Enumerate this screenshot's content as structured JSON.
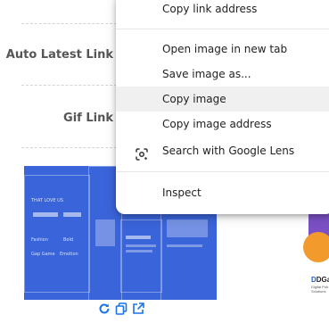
{
  "page": {
    "row_labels": [
      "Auto Latest Link",
      "Gif Link"
    ],
    "thumbnail": {
      "texts": [
        "THAT LOVE US",
        "Fashion",
        "Bold",
        "Gap Game",
        "Emotion"
      ],
      "actions": [
        {
          "icon": "refresh-icon"
        },
        {
          "icon": "copy-icon"
        },
        {
          "icon": "open-external-icon"
        }
      ]
    },
    "preview_right": {
      "logo": "DGati",
      "tagline": [
        "Digital Pub",
        "Solutions"
      ]
    }
  },
  "context_menu": {
    "items": [
      {
        "label": "Copy link address"
      },
      {
        "label": "Open image in new tab"
      },
      {
        "label": "Save image as..."
      },
      {
        "label": "Copy image",
        "highlighted": true
      },
      {
        "label": "Copy image address"
      },
      {
        "label": "Search with Google Lens",
        "icon": "google-lens-icon"
      },
      {
        "label": "Inspect"
      }
    ]
  },
  "colors": {
    "thumbnail_bg": "#3a64d9",
    "action_icon": "#1a73e8",
    "menu_highlight": "#f0f0f0"
  }
}
